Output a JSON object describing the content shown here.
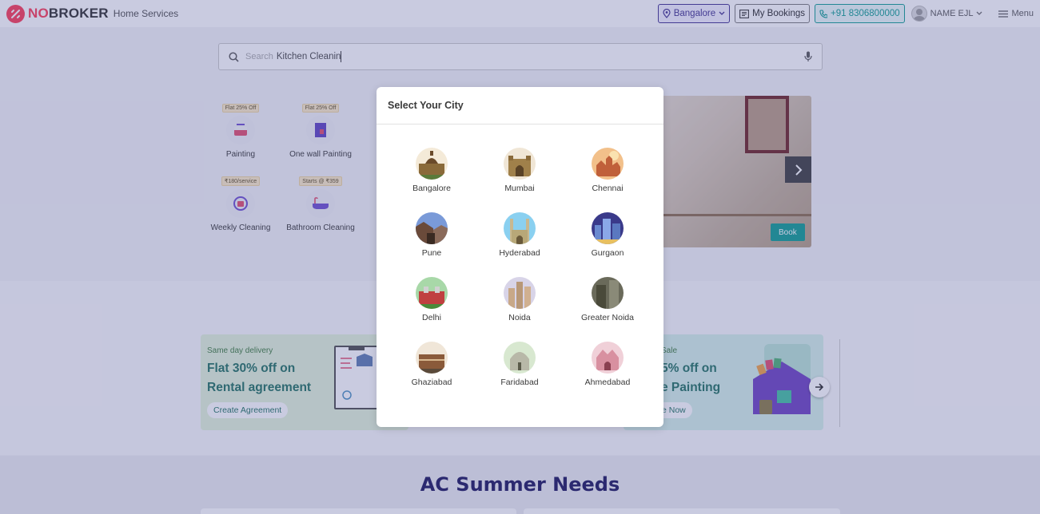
{
  "header": {
    "brand_prefix": "NO",
    "brand_suffix": "BROKER",
    "subtitle": "Home Services",
    "city_label": "Bangalore",
    "bookings_label": "My Bookings",
    "phone_label": "+91 8306800000",
    "user_name": "NAME EJL",
    "menu_label": "Menu"
  },
  "search": {
    "placeholder": "Search",
    "value": "Kitchen Cleanin"
  },
  "services": [
    {
      "badge": "Flat 25% Off",
      "label": "Painting"
    },
    {
      "badge": "Flat 25% Off",
      "label": "One wall Painting"
    },
    {
      "badge": "₹180/service",
      "label": "Weekly Cleaning"
    },
    {
      "badge": "Starts @ ₹359",
      "label": "Bathroom Cleaning"
    }
  ],
  "banner": {
    "book_label": "Book"
  },
  "offers": [
    {
      "tag": "Same day delivery",
      "title_line1": "Flat 30% off on",
      "title_line2": "Rental agreement",
      "cta": "Create Agreement"
    },
    {
      "tag": "Sale",
      "title_line1": "5% off on",
      "title_line2": "e Painting",
      "cta": "e Now"
    }
  ],
  "ac_section": {
    "title": "AC Summer Needs"
  },
  "city_modal": {
    "title": "Select Your City",
    "cities": [
      {
        "name": "Bangalore",
        "icon": "bangalore-landmark-icon"
      },
      {
        "name": "Mumbai",
        "icon": "mumbai-landmark-icon"
      },
      {
        "name": "Chennai",
        "icon": "chennai-landmark-icon"
      },
      {
        "name": "Pune",
        "icon": "pune-landmark-icon"
      },
      {
        "name": "Hyderabad",
        "icon": "hyderabad-landmark-icon"
      },
      {
        "name": "Gurgaon",
        "icon": "gurgaon-landmark-icon"
      },
      {
        "name": "Delhi",
        "icon": "delhi-landmark-icon"
      },
      {
        "name": "Noida",
        "icon": "noida-landmark-icon"
      },
      {
        "name": "Greater Noida",
        "icon": "greater-noida-landmark-icon"
      },
      {
        "name": "Ghaziabad",
        "icon": "ghaziabad-landmark-icon"
      },
      {
        "name": "Faridabad",
        "icon": "faridabad-landmark-icon"
      },
      {
        "name": "Ahmedabad",
        "icon": "ahmedabad-landmark-icon"
      }
    ]
  },
  "colors": {
    "brand_red": "#fd3752",
    "accent_teal": "#0a9b8f",
    "accent_purple": "#3b2b8e"
  }
}
